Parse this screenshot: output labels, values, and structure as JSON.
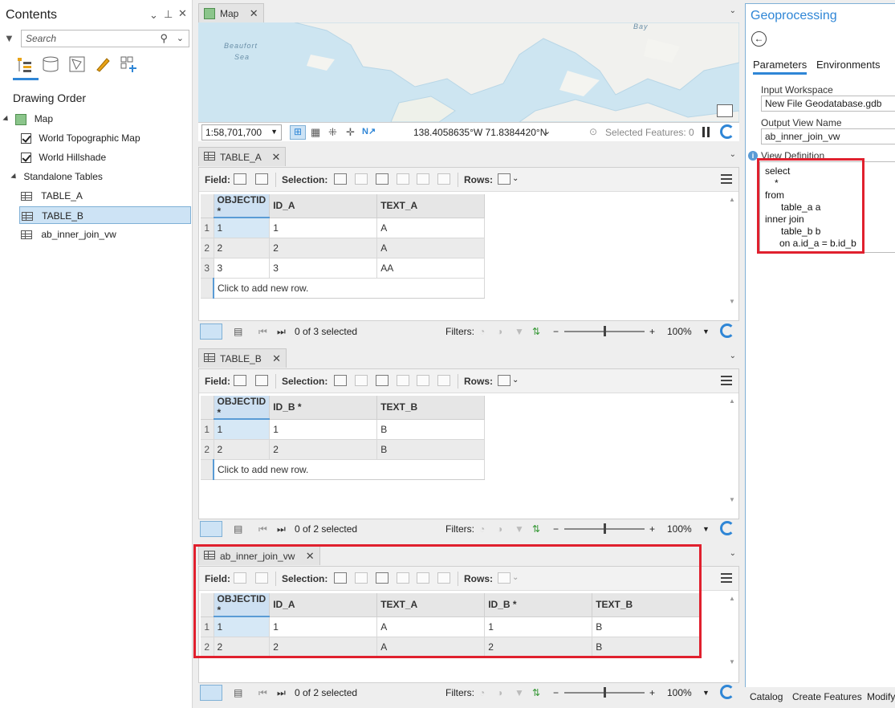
{
  "contents": {
    "title": "Contents",
    "search_placeholder": "Search",
    "drawing_order": "Drawing Order",
    "map_label": "Map",
    "layers": [
      "World Topographic Map",
      "World Hillshade"
    ],
    "standalone_tables_label": "Standalone Tables",
    "tables": [
      "TABLE_A",
      "TABLE_B",
      "ab_inner_join_vw"
    ],
    "selected_table": "TABLE_B"
  },
  "map_view": {
    "tab_label": "Map",
    "labels": {
      "beaufort": "Beaufort",
      "sea": "Sea",
      "bay": "Bay"
    },
    "scale": "1:58,701,700",
    "coordinates": "138.4058635°W 71.8384420°N",
    "selected_features": "Selected Features: 0"
  },
  "toolbar_labels": {
    "field": "Field:",
    "selection": "Selection:",
    "rows": "Rows:",
    "filters": "Filters:",
    "zoom": "100%"
  },
  "table_a": {
    "tab_label": "TABLE_A",
    "columns": [
      "OBJECTID *",
      "ID_A",
      "TEXT_A"
    ],
    "rows": [
      {
        "n": "1",
        "cells": [
          "1",
          "1",
          "A"
        ]
      },
      {
        "n": "2",
        "cells": [
          "2",
          "2",
          "A"
        ]
      },
      {
        "n": "3",
        "cells": [
          "3",
          "3",
          "AA"
        ]
      }
    ],
    "add_row": "Click to add new row.",
    "status": "0 of 3 selected"
  },
  "table_b": {
    "tab_label": "TABLE_B",
    "columns": [
      "OBJECTID *",
      "ID_B *",
      "TEXT_B"
    ],
    "rows": [
      {
        "n": "1",
        "cells": [
          "1",
          "1",
          "B"
        ]
      },
      {
        "n": "2",
        "cells": [
          "2",
          "2",
          "B"
        ]
      }
    ],
    "add_row": "Click to add new row.",
    "status": "0 of 2 selected"
  },
  "view_table": {
    "tab_label": "ab_inner_join_vw",
    "columns": [
      "OBJECTID *",
      "ID_A",
      "TEXT_A",
      "ID_B *",
      "TEXT_B"
    ],
    "rows": [
      {
        "n": "1",
        "cells": [
          "1",
          "1",
          "A",
          "1",
          "B"
        ]
      },
      {
        "n": "2",
        "cells": [
          "2",
          "2",
          "A",
          "2",
          "B"
        ]
      }
    ],
    "status": "0 of 2 selected"
  },
  "geoprocessing": {
    "title": "Geoprocessing",
    "tabs": [
      "Parameters",
      "Environments"
    ],
    "input_workspace_label": "Input Workspace",
    "input_workspace": "New File Geodatabase.gdb",
    "output_view_label": "Output View Name",
    "output_view": "ab_inner_join_vw",
    "view_definition_label": "View Definition",
    "sql_lines": [
      "select",
      "    *",
      "from",
      "    table_a a",
      "inner join",
      "    table_b b",
      "    on a.id_a = b.id_b"
    ],
    "bottom_tabs": [
      "Catalog",
      "Create Features",
      "Modify"
    ]
  },
  "colors": {
    "accent": "#2f86d6",
    "highlight_box": "#e0202e",
    "selection_bg": "#cde3f5"
  }
}
